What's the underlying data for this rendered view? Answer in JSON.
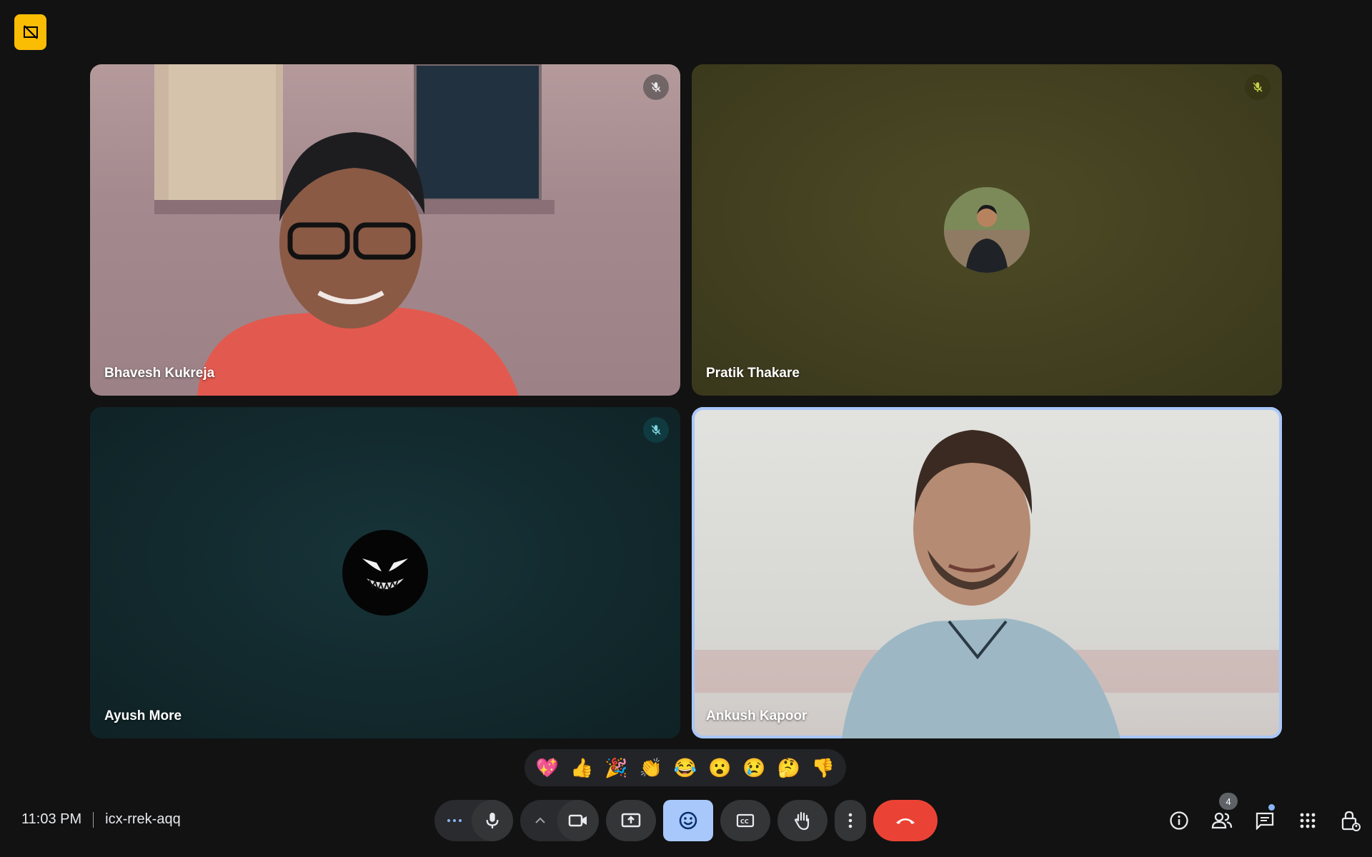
{
  "meeting": {
    "time": "11:03 PM",
    "code": "icx-rrek-aqq",
    "participant_count": "4"
  },
  "participants": [
    {
      "name": "Bhavesh Kukreja",
      "muted": true,
      "video": true
    },
    {
      "name": "Pratik Thakare",
      "muted": true,
      "video": false
    },
    {
      "name": "Ayush More",
      "muted": true,
      "video": false
    },
    {
      "name": "Ankush Kapoor",
      "muted": false,
      "video": true,
      "speaking": true
    }
  ],
  "reactions": [
    "💖",
    "👍",
    "🎉",
    "👏",
    "😂",
    "😮",
    "😢",
    "🤔",
    "👎"
  ],
  "controls": [
    "more-options",
    "microphone",
    "camera-options",
    "camera",
    "present",
    "emoji",
    "captions",
    "raise-hand",
    "more-actions",
    "leave-call"
  ],
  "right_controls": [
    "meeting-info",
    "people",
    "chat",
    "activities",
    "host-controls"
  ],
  "colors": {
    "background": "#121212",
    "accent_badge": "#fbbc04",
    "hangup": "#ea4335",
    "active_button": "#a8c7fa",
    "tile_pratik": "#434120",
    "tile_ayush": "#12292d"
  }
}
